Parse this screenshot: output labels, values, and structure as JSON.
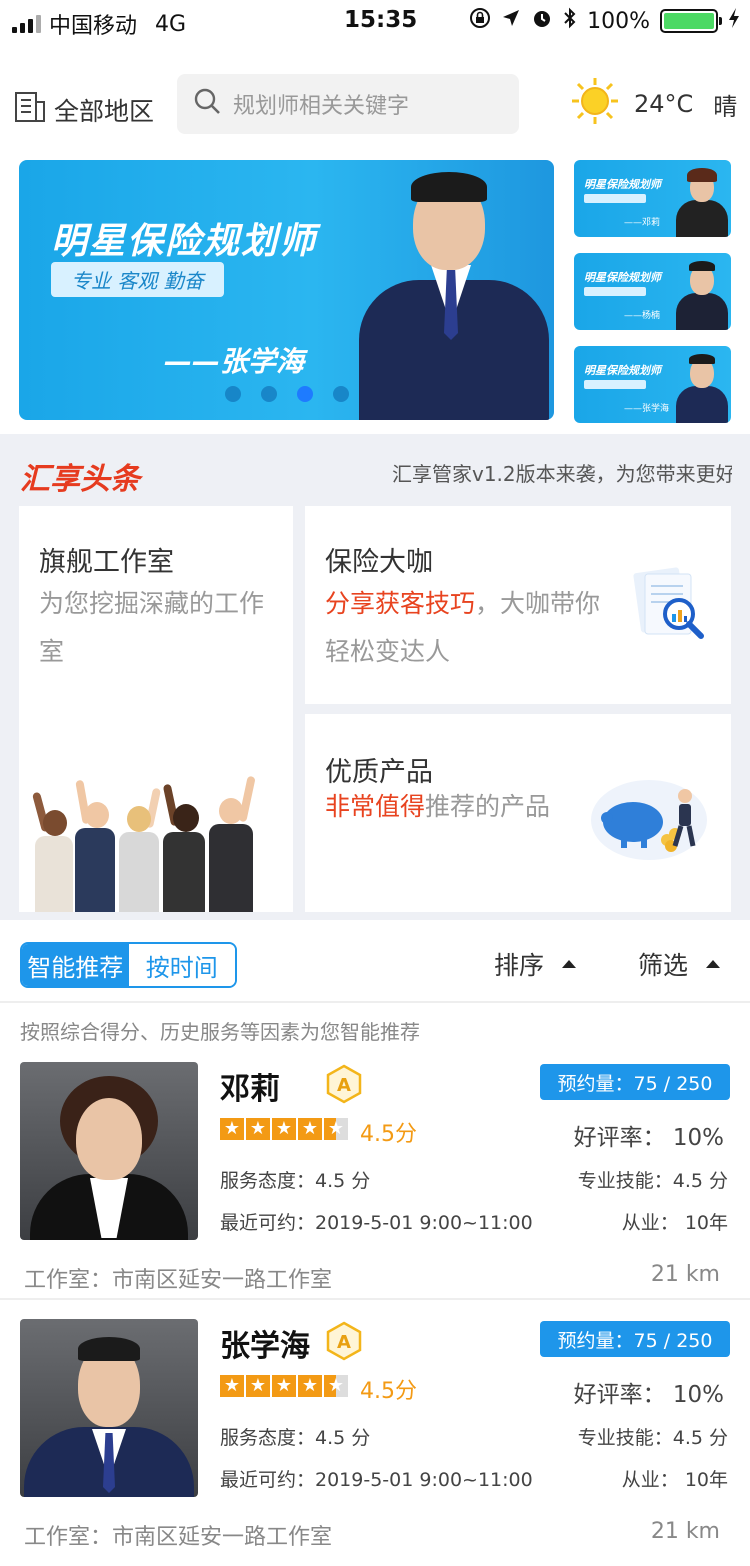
{
  "status_bar": {
    "carrier": "中国移动",
    "network": "4G",
    "time": "15:35",
    "battery": "100%"
  },
  "header": {
    "region_label": "全部地区",
    "search_placeholder": "规划师相关关键字",
    "temperature": "24°C",
    "weather": "晴"
  },
  "banner": {
    "title": "明星保险规划师",
    "tags": "专业 客观 勤奋",
    "signature": "——张学海",
    "dots_count": 4,
    "active_dot": 2,
    "thumbnails": [
      {
        "title": "明星保险规划师",
        "caption": "——邓莉"
      },
      {
        "title": "明星保险规划师",
        "caption": "——杨楠"
      },
      {
        "title": "明星保险规划师",
        "caption": "——张学海"
      }
    ]
  },
  "news": {
    "logo": "汇享头条",
    "headline": "汇享管家v1.2版本来袭，为您带来更好"
  },
  "features": {
    "flagship": {
      "title": "旗舰工作室",
      "desc": "为您挖掘深藏的工作室"
    },
    "expert": {
      "title": "保险大咖",
      "highlight": "分享获客技巧",
      "desc_rest": "，大咖带你轻松变达人"
    },
    "product": {
      "title": "优质产品",
      "highlight": "非常值得",
      "desc_rest": "推荐的产品"
    }
  },
  "list_controls": {
    "tab_smart": "智能推荐",
    "tab_time": "按时间",
    "sort_label": "排序",
    "filter_label": "筛选",
    "hint": "按照综合得分、历史服务等因素为您智能推荐"
  },
  "planners": [
    {
      "name": "邓莉",
      "grade": "A",
      "score": "4.5分",
      "rating": 4.5,
      "service": "服务态度：4.5 分",
      "available": "最近可约：2019-5-01  9:00~11:00",
      "booking": "预约量：75 / 250",
      "good_rate": "好评率：  10%",
      "skill": "专业技能：4.5 分",
      "years": "从业：  10年",
      "studio": "工作室：市南区延安一路工作室",
      "distance": "21 km"
    },
    {
      "name": "张学海",
      "grade": "A",
      "score": "4.5分",
      "rating": 4.5,
      "service": "服务态度：4.5 分",
      "available": "最近可约：2019-5-01  9:00~11:00",
      "booking": "预约量：75 / 250",
      "good_rate": "好评率：  10%",
      "skill": "专业技能：4.5 分",
      "years": "从业：  10年",
      "studio": "工作室：市南区延安一路工作室",
      "distance": "21 km"
    }
  ],
  "colors": {
    "accent": "#1e96ea",
    "highlight": "#e8431f",
    "star": "#f39a14"
  }
}
